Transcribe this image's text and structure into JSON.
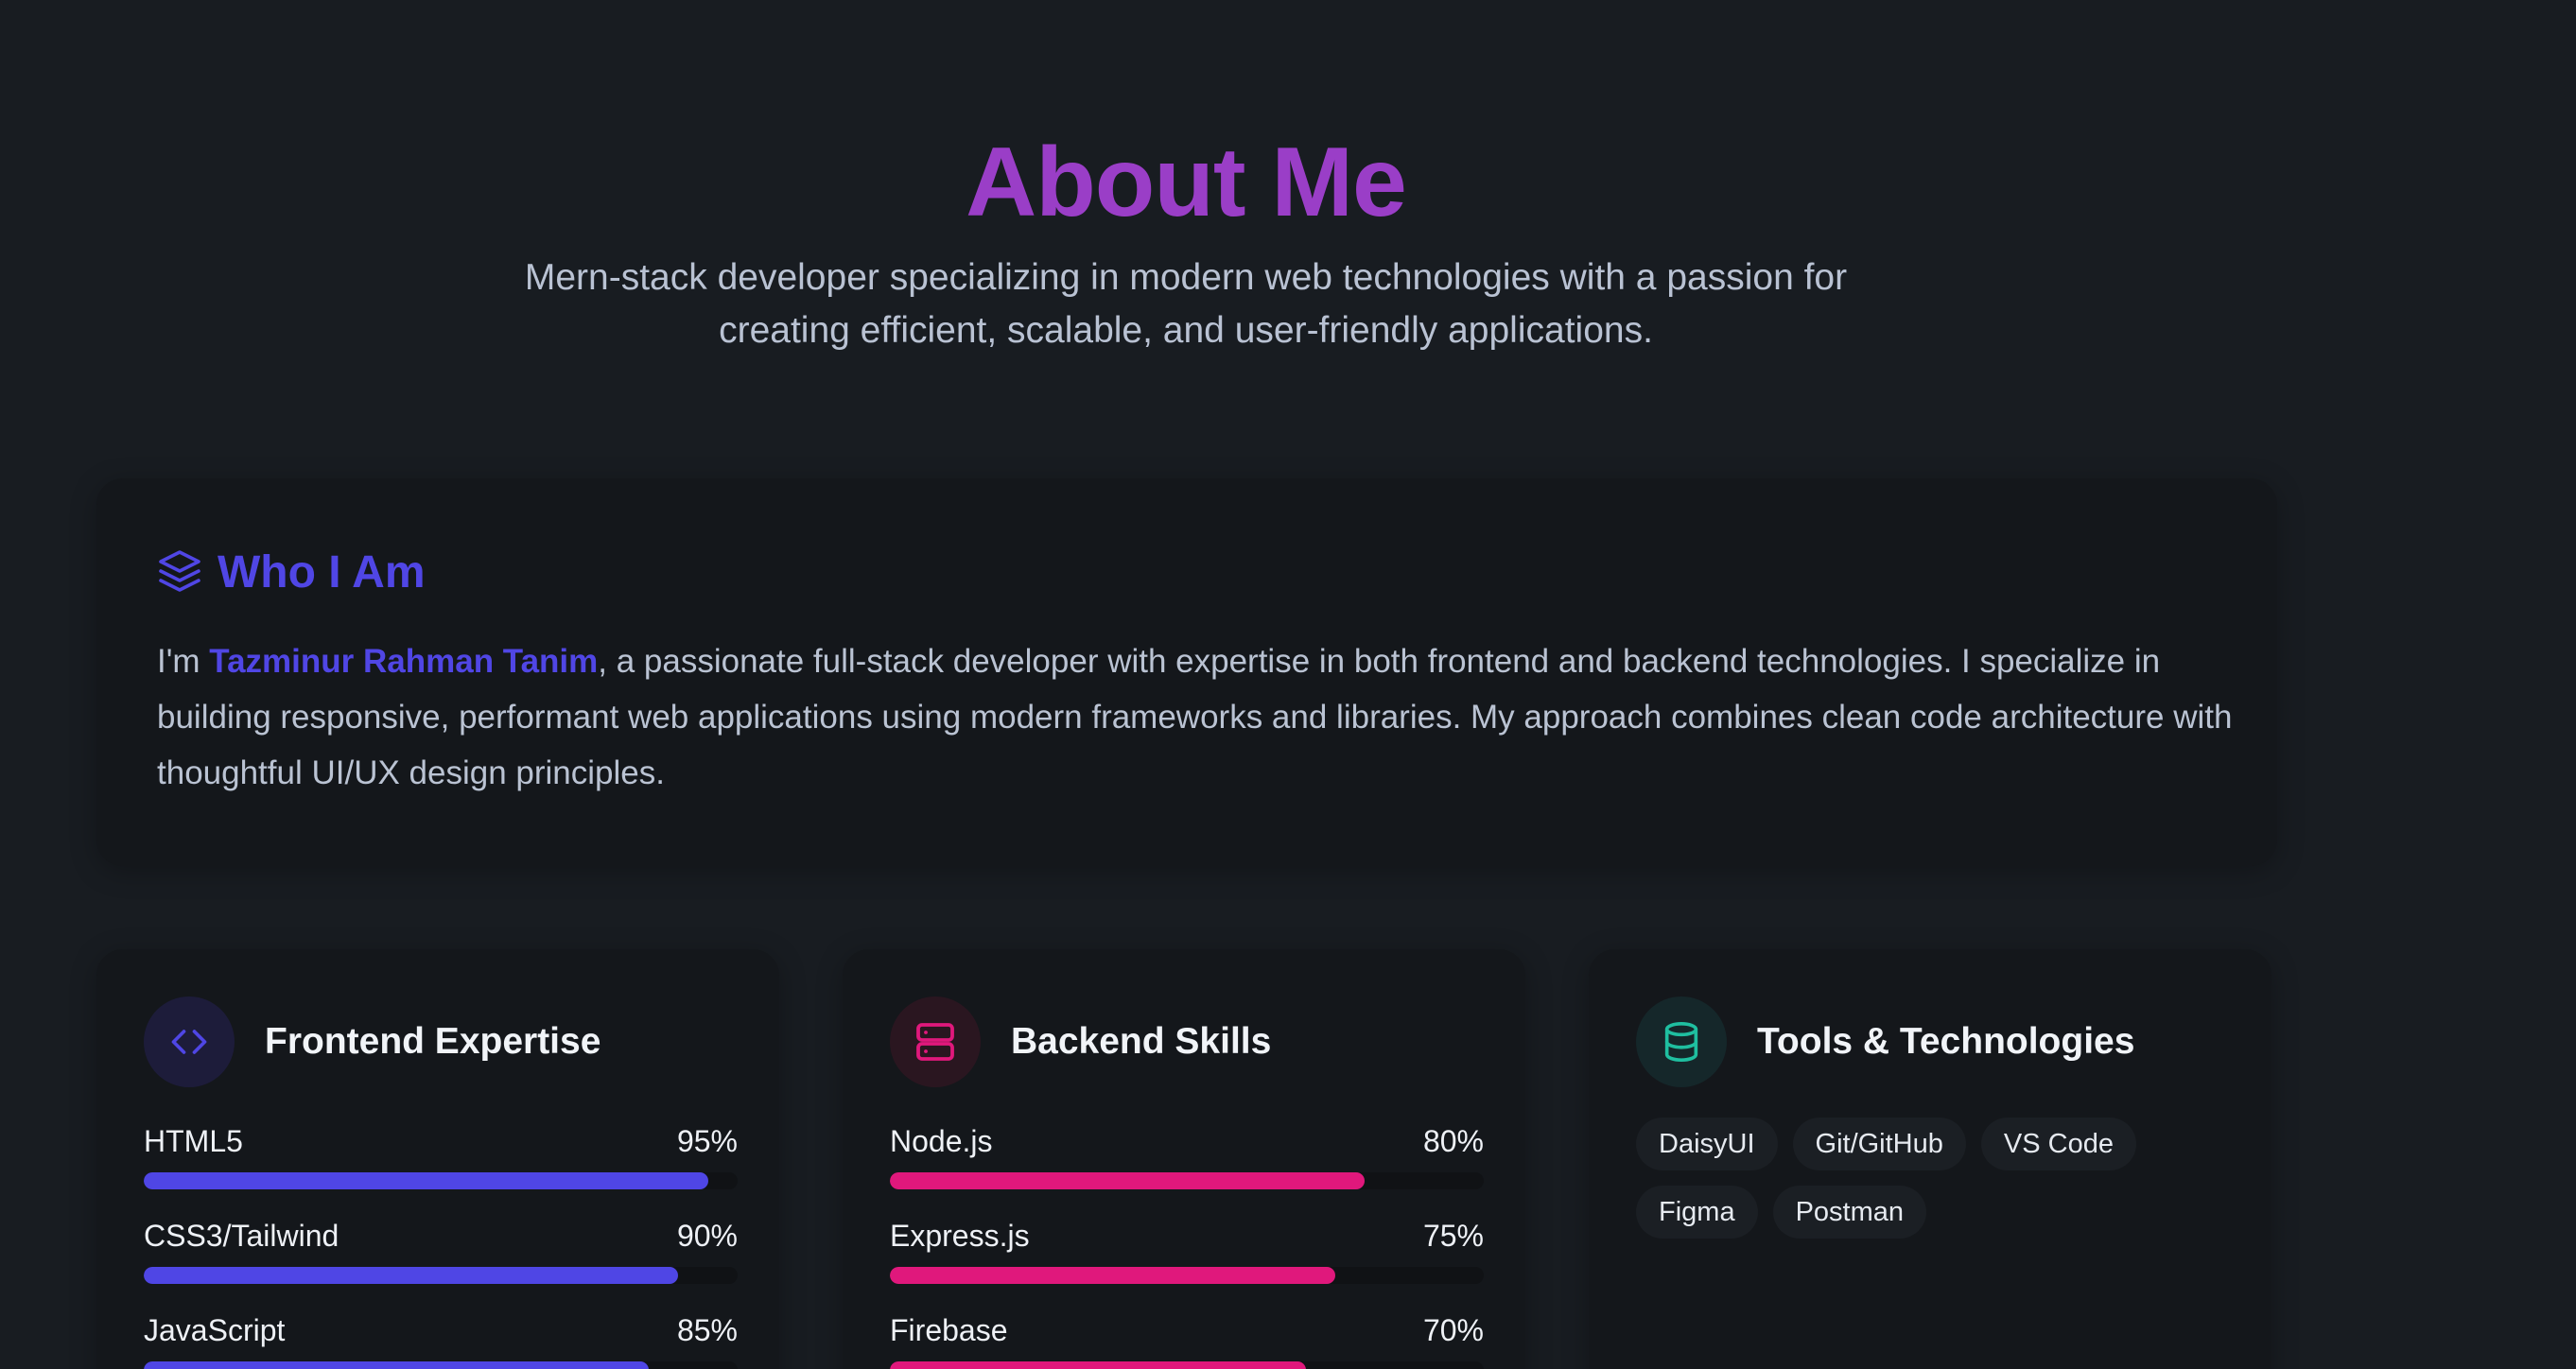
{
  "hero": {
    "title": "About Me",
    "subtitle_line1": "Mern-stack developer specializing in modern web technologies with a passion for",
    "subtitle_line2": "creating efficient, scalable, and user-friendly applications."
  },
  "who": {
    "title": "Who I Am",
    "intro": "I'm ",
    "name": "Tazminur Rahman Tanim",
    "body": ", a passionate full-stack developer with expertise in both frontend and backend technologies. I specialize in building responsive, performant web applications using modern frameworks and libraries. My approach combines clean code architecture with thoughtful UI/UX design principles.",
    "icon": "layers-icon",
    "accent": "#5046e5"
  },
  "frontend": {
    "title": "Frontend Expertise",
    "icon": "code-icon",
    "accent": "#4f46e5",
    "skills": [
      {
        "name": "HTML5",
        "percent": "95%",
        "value": 95
      },
      {
        "name": "CSS3/Tailwind",
        "percent": "90%",
        "value": 90
      },
      {
        "name": "JavaScript",
        "percent": "85%",
        "value": 85
      }
    ]
  },
  "backend": {
    "title": "Backend Skills",
    "icon": "server-icon",
    "accent": "#e0187c",
    "skills": [
      {
        "name": "Node.js",
        "percent": "80%",
        "value": 80
      },
      {
        "name": "Express.js",
        "percent": "75%",
        "value": 75
      },
      {
        "name": "Firebase",
        "percent": "70%",
        "value": 70
      }
    ]
  },
  "tools": {
    "title": "Tools & Technologies",
    "icon": "database-icon",
    "accent": "#1fbfa0",
    "tags": [
      "DaisyUI",
      "Git/GitHub",
      "VS Code",
      "Figma",
      "Postman"
    ]
  }
}
